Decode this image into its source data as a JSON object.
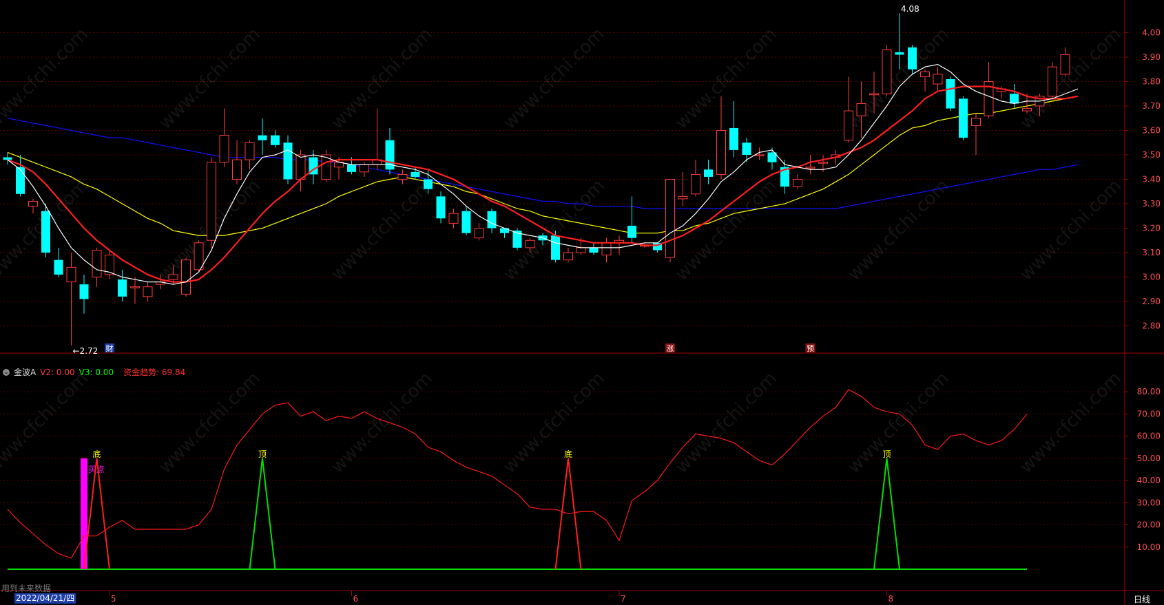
{
  "indicator": {
    "name": "金波A",
    "v2_label": "V2: 0.00",
    "v3_label": "V3: 0.00",
    "trend_label": "资金趋势: 69.84"
  },
  "footer": {
    "note": "用到未来数据",
    "date": "2022/04/21/四",
    "period": "日线"
  },
  "watermark": "www.cfchi.com",
  "colors": {
    "up": "#ff3c3c",
    "down": "#00ffff",
    "ma5": "#ffffff",
    "ma10": "#ff2020",
    "ma20": "#ffff00",
    "ma60": "#1010ff",
    "axis": "#a00000",
    "grid": "#5a0000",
    "trend": "#ff1a1a",
    "signal_bottom": "#ff2020",
    "signal_top": "#00e000",
    "magenta": "#ff00ff"
  },
  "chart_data": [
    {
      "type": "candlestick",
      "ylim": [
        2.7,
        4.1
      ],
      "y_ticks": [
        "2.80",
        "2.90",
        "3.00",
        "3.10",
        "3.20",
        "3.30",
        "3.40",
        "3.50",
        "3.60",
        "3.70",
        "3.80",
        "3.90",
        "4.00"
      ],
      "candles": [
        {
          "o": 3.49,
          "h": 3.51,
          "l": 3.46,
          "c": 3.48
        },
        {
          "o": 3.45,
          "h": 3.5,
          "l": 3.33,
          "c": 3.34
        },
        {
          "o": 3.29,
          "h": 3.32,
          "l": 3.26,
          "c": 3.31
        },
        {
          "o": 3.27,
          "h": 3.3,
          "l": 3.08,
          "c": 3.1
        },
        {
          "o": 3.07,
          "h": 3.12,
          "l": 3.0,
          "c": 3.01
        },
        {
          "o": 2.98,
          "h": 3.1,
          "l": 2.72,
          "c": 3.04
        },
        {
          "o": 2.97,
          "h": 3.01,
          "l": 2.85,
          "c": 2.91
        },
        {
          "o": 3.0,
          "h": 3.12,
          "l": 2.96,
          "c": 3.11
        },
        {
          "o": 3.01,
          "h": 3.11,
          "l": 2.99,
          "c": 3.09
        },
        {
          "o": 2.99,
          "h": 3.03,
          "l": 2.9,
          "c": 2.92
        },
        {
          "o": 2.96,
          "h": 3.0,
          "l": 2.89,
          "c": 2.96
        },
        {
          "o": 2.92,
          "h": 2.98,
          "l": 2.9,
          "c": 2.96
        },
        {
          "o": 2.97,
          "h": 3.01,
          "l": 2.95,
          "c": 2.98
        },
        {
          "o": 2.99,
          "h": 3.05,
          "l": 2.97,
          "c": 3.01
        },
        {
          "o": 2.93,
          "h": 3.08,
          "l": 2.92,
          "c": 3.07
        },
        {
          "o": 3.03,
          "h": 3.15,
          "l": 3.02,
          "c": 3.14
        },
        {
          "o": 3.15,
          "h": 3.49,
          "l": 3.12,
          "c": 3.47
        },
        {
          "o": 3.47,
          "h": 3.69,
          "l": 3.45,
          "c": 3.58
        },
        {
          "o": 3.4,
          "h": 3.56,
          "l": 3.38,
          "c": 3.48
        },
        {
          "o": 3.48,
          "h": 3.56,
          "l": 3.44,
          "c": 3.55
        },
        {
          "o": 3.58,
          "h": 3.65,
          "l": 3.5,
          "c": 3.56
        },
        {
          "o": 3.58,
          "h": 3.6,
          "l": 3.53,
          "c": 3.54
        },
        {
          "o": 3.55,
          "h": 3.58,
          "l": 3.38,
          "c": 3.4
        },
        {
          "o": 3.4,
          "h": 3.52,
          "l": 3.35,
          "c": 3.5
        },
        {
          "o": 3.49,
          "h": 3.52,
          "l": 3.38,
          "c": 3.42
        },
        {
          "o": 3.4,
          "h": 3.52,
          "l": 3.39,
          "c": 3.5
        },
        {
          "o": 3.45,
          "h": 3.49,
          "l": 3.4,
          "c": 3.47
        },
        {
          "o": 3.46,
          "h": 3.49,
          "l": 3.42,
          "c": 3.43
        },
        {
          "o": 3.43,
          "h": 3.47,
          "l": 3.41,
          "c": 3.46
        },
        {
          "o": 3.46,
          "h": 3.69,
          "l": 3.44,
          "c": 3.48
        },
        {
          "o": 3.56,
          "h": 3.61,
          "l": 3.42,
          "c": 3.44
        },
        {
          "o": 3.4,
          "h": 3.44,
          "l": 3.38,
          "c": 3.42
        },
        {
          "o": 3.43,
          "h": 3.45,
          "l": 3.4,
          "c": 3.41
        },
        {
          "o": 3.4,
          "h": 3.44,
          "l": 3.34,
          "c": 3.36
        },
        {
          "o": 3.33,
          "h": 3.35,
          "l": 3.22,
          "c": 3.24
        },
        {
          "o": 3.22,
          "h": 3.28,
          "l": 3.2,
          "c": 3.26
        },
        {
          "o": 3.27,
          "h": 3.29,
          "l": 3.17,
          "c": 3.18
        },
        {
          "o": 3.16,
          "h": 3.22,
          "l": 3.15,
          "c": 3.2
        },
        {
          "o": 3.27,
          "h": 3.28,
          "l": 3.18,
          "c": 3.2
        },
        {
          "o": 3.2,
          "h": 3.2,
          "l": 3.16,
          "c": 3.18
        },
        {
          "o": 3.19,
          "h": 3.2,
          "l": 3.11,
          "c": 3.12
        },
        {
          "o": 3.12,
          "h": 3.16,
          "l": 3.1,
          "c": 3.15
        },
        {
          "o": 3.17,
          "h": 3.18,
          "l": 3.13,
          "c": 3.15
        },
        {
          "o": 3.17,
          "h": 3.19,
          "l": 3.06,
          "c": 3.07
        },
        {
          "o": 3.07,
          "h": 3.12,
          "l": 3.06,
          "c": 3.1
        },
        {
          "o": 3.1,
          "h": 3.16,
          "l": 3.09,
          "c": 3.12
        },
        {
          "o": 3.12,
          "h": 3.14,
          "l": 3.09,
          "c": 3.1
        },
        {
          "o": 3.09,
          "h": 3.16,
          "l": 3.06,
          "c": 3.14
        },
        {
          "o": 3.14,
          "h": 3.17,
          "l": 3.09,
          "c": 3.15
        },
        {
          "o": 3.21,
          "h": 3.33,
          "l": 3.14,
          "c": 3.16
        },
        {
          "o": 3.13,
          "h": 3.14,
          "l": 3.12,
          "c": 3.13
        },
        {
          "o": 3.14,
          "h": 3.14,
          "l": 3.1,
          "c": 3.11
        },
        {
          "o": 3.08,
          "h": 3.4,
          "l": 3.06,
          "c": 3.4
        },
        {
          "o": 3.32,
          "h": 3.43,
          "l": 3.29,
          "c": 3.33
        },
        {
          "o": 3.34,
          "h": 3.48,
          "l": 3.33,
          "c": 3.42
        },
        {
          "o": 3.44,
          "h": 3.48,
          "l": 3.38,
          "c": 3.41
        },
        {
          "o": 3.42,
          "h": 3.74,
          "l": 3.4,
          "c": 3.6
        },
        {
          "o": 3.61,
          "h": 3.72,
          "l": 3.49,
          "c": 3.52
        },
        {
          "o": 3.55,
          "h": 3.57,
          "l": 3.47,
          "c": 3.5
        },
        {
          "o": 3.5,
          "h": 3.53,
          "l": 3.48,
          "c": 3.5
        },
        {
          "o": 3.51,
          "h": 3.53,
          "l": 3.44,
          "c": 3.47
        },
        {
          "o": 3.45,
          "h": 3.48,
          "l": 3.34,
          "c": 3.37
        },
        {
          "o": 3.37,
          "h": 3.42,
          "l": 3.36,
          "c": 3.4
        },
        {
          "o": 3.45,
          "h": 3.5,
          "l": 3.42,
          "c": 3.45
        },
        {
          "o": 3.47,
          "h": 3.5,
          "l": 3.43,
          "c": 3.47
        },
        {
          "o": 3.49,
          "h": 3.52,
          "l": 3.46,
          "c": 3.5
        },
        {
          "o": 3.56,
          "h": 3.82,
          "l": 3.55,
          "c": 3.68
        },
        {
          "o": 3.66,
          "h": 3.8,
          "l": 3.57,
          "c": 3.71
        },
        {
          "o": 3.75,
          "h": 3.84,
          "l": 3.67,
          "c": 3.75
        },
        {
          "o": 3.75,
          "h": 3.95,
          "l": 3.74,
          "c": 3.93
        },
        {
          "o": 3.92,
          "h": 4.08,
          "l": 3.85,
          "c": 3.91
        },
        {
          "o": 3.94,
          "h": 3.95,
          "l": 3.83,
          "c": 3.85
        },
        {
          "o": 3.82,
          "h": 3.85,
          "l": 3.76,
          "c": 3.84
        },
        {
          "o": 3.79,
          "h": 3.86,
          "l": 3.76,
          "c": 3.83
        },
        {
          "o": 3.81,
          "h": 3.82,
          "l": 3.68,
          "c": 3.69
        },
        {
          "o": 3.73,
          "h": 3.74,
          "l": 3.56,
          "c": 3.57
        },
        {
          "o": 3.62,
          "h": 3.67,
          "l": 3.5,
          "c": 3.65
        },
        {
          "o": 3.66,
          "h": 3.88,
          "l": 3.65,
          "c": 3.8
        },
        {
          "o": 3.76,
          "h": 3.78,
          "l": 3.73,
          "c": 3.77
        },
        {
          "o": 3.75,
          "h": 3.79,
          "l": 3.69,
          "c": 3.71
        },
        {
          "o": 3.68,
          "h": 3.75,
          "l": 3.67,
          "c": 3.69
        },
        {
          "o": 3.7,
          "h": 3.75,
          "l": 3.66,
          "c": 3.74
        },
        {
          "o": 3.74,
          "h": 3.88,
          "l": 3.73,
          "c": 3.86
        },
        {
          "o": 3.83,
          "h": 3.94,
          "l": 3.82,
          "c": 3.91
        }
      ],
      "ma5": [
        3.48,
        3.44,
        3.37,
        3.29,
        3.2,
        3.12,
        3.07,
        3.03,
        3.02,
        3.0,
        2.99,
        2.98,
        2.98,
        2.97,
        2.98,
        3.02,
        3.11,
        3.24,
        3.34,
        3.43,
        3.49,
        3.5,
        3.52,
        3.49,
        3.5,
        3.49,
        3.47,
        3.46,
        3.46,
        3.46,
        3.46,
        3.45,
        3.44,
        3.42,
        3.38,
        3.34,
        3.29,
        3.25,
        3.22,
        3.2,
        3.18,
        3.17,
        3.16,
        3.14,
        3.13,
        3.12,
        3.12,
        3.12,
        3.12,
        3.13,
        3.14,
        3.14,
        3.18,
        3.21,
        3.26,
        3.32,
        3.39,
        3.43,
        3.48,
        3.51,
        3.52,
        3.46,
        3.45,
        3.44,
        3.44,
        3.45,
        3.5,
        3.56,
        3.63,
        3.7,
        3.78,
        3.83,
        3.86,
        3.87,
        3.84,
        3.79,
        3.76,
        3.74,
        3.72,
        3.71,
        3.72,
        3.72,
        3.73,
        3.75,
        3.77
      ],
      "ma10": [
        3.48,
        3.46,
        3.43,
        3.38,
        3.32,
        3.26,
        3.2,
        3.15,
        3.11,
        3.07,
        3.04,
        3.01,
        2.99,
        2.98,
        2.98,
        2.99,
        3.03,
        3.08,
        3.14,
        3.2,
        3.26,
        3.31,
        3.35,
        3.4,
        3.44,
        3.47,
        3.48,
        3.48,
        3.48,
        3.48,
        3.47,
        3.46,
        3.45,
        3.44,
        3.42,
        3.4,
        3.37,
        3.34,
        3.31,
        3.29,
        3.26,
        3.23,
        3.2,
        3.17,
        3.16,
        3.15,
        3.14,
        3.14,
        3.14,
        3.14,
        3.13,
        3.13,
        3.15,
        3.17,
        3.2,
        3.23,
        3.27,
        3.31,
        3.35,
        3.39,
        3.42,
        3.44,
        3.45,
        3.47,
        3.48,
        3.49,
        3.51,
        3.53,
        3.56,
        3.6,
        3.64,
        3.68,
        3.73,
        3.76,
        3.77,
        3.78,
        3.78,
        3.78,
        3.77,
        3.76,
        3.74,
        3.73,
        3.73,
        3.73,
        3.74
      ],
      "ma20": [
        3.51,
        3.49,
        3.47,
        3.45,
        3.43,
        3.41,
        3.38,
        3.36,
        3.33,
        3.3,
        3.27,
        3.24,
        3.22,
        3.19,
        3.18,
        3.17,
        3.17,
        3.17,
        3.18,
        3.19,
        3.2,
        3.22,
        3.24,
        3.26,
        3.28,
        3.3,
        3.33,
        3.35,
        3.37,
        3.39,
        3.4,
        3.41,
        3.4,
        3.39,
        3.38,
        3.37,
        3.35,
        3.34,
        3.32,
        3.3,
        3.28,
        3.27,
        3.25,
        3.24,
        3.23,
        3.22,
        3.21,
        3.2,
        3.19,
        3.18,
        3.18,
        3.18,
        3.19,
        3.19,
        3.21,
        3.22,
        3.24,
        3.26,
        3.27,
        3.28,
        3.29,
        3.3,
        3.32,
        3.34,
        3.36,
        3.39,
        3.42,
        3.46,
        3.5,
        3.54,
        3.58,
        3.61,
        3.62,
        3.64,
        3.65,
        3.66,
        3.67,
        3.67,
        3.68,
        3.69,
        3.7,
        3.71,
        3.72,
        3.73,
        3.74
      ],
      "ma60": [
        3.65,
        3.64,
        3.63,
        3.62,
        3.61,
        3.6,
        3.59,
        3.58,
        3.57,
        3.57,
        3.56,
        3.55,
        3.54,
        3.53,
        3.52,
        3.51,
        3.5,
        3.49,
        3.49,
        3.49,
        3.49,
        3.49,
        3.48,
        3.48,
        3.48,
        3.47,
        3.47,
        3.46,
        3.45,
        3.44,
        3.43,
        3.42,
        3.41,
        3.4,
        3.39,
        3.38,
        3.37,
        3.36,
        3.35,
        3.34,
        3.33,
        3.32,
        3.31,
        3.31,
        3.3,
        3.3,
        3.29,
        3.29,
        3.29,
        3.29,
        3.28,
        3.28,
        3.28,
        3.28,
        3.28,
        3.28,
        3.28,
        3.28,
        3.28,
        3.28,
        3.28,
        3.28,
        3.28,
        3.28,
        3.28,
        3.28,
        3.29,
        3.3,
        3.31,
        3.32,
        3.33,
        3.34,
        3.35,
        3.36,
        3.37,
        3.38,
        3.39,
        3.4,
        3.41,
        3.42,
        3.43,
        3.44,
        3.44,
        3.45,
        3.46
      ],
      "annotations": [
        {
          "text": "←2.72",
          "index": 5,
          "price": 2.72
        },
        {
          "text": "4.08",
          "index": 70,
          "price": 4.08
        }
      ],
      "event_markers": [
        {
          "text": "财",
          "index": 8,
          "color": "#ffffff",
          "bg": "#1e3fa8"
        },
        {
          "text": "涨",
          "index": 52,
          "color": "#ffffff",
          "bg": "#8a1010"
        },
        {
          "text": "预",
          "index": 63,
          "color": "#ffffff",
          "bg": "#8a1010"
        }
      ]
    },
    {
      "type": "line",
      "ylim": [
        0,
        90
      ],
      "y_ticks": [
        "10.00",
        "20.00",
        "30.00",
        "40.00",
        "50.00",
        "60.00",
        "70.00",
        "80.00"
      ],
      "trend": [
        27,
        21,
        16,
        11,
        7,
        5,
        15,
        15,
        19,
        22,
        18,
        18,
        18,
        18,
        18,
        20,
        27,
        45,
        56,
        63,
        70,
        74,
        75,
        69,
        71,
        67,
        69,
        68,
        71,
        68,
        66,
        64,
        61,
        55,
        53,
        49,
        46,
        44,
        42,
        38,
        34,
        28,
        27,
        27,
        25,
        26,
        26,
        22,
        13,
        31,
        35,
        40,
        48,
        55,
        61,
        60,
        59,
        57,
        53,
        49,
        47,
        52,
        58,
        64,
        69,
        73,
        81,
        78,
        73,
        71,
        70,
        65,
        56,
        54,
        60,
        61,
        58,
        56,
        58,
        63,
        70
      ],
      "signals": [
        {
          "type": "bottom",
          "index": 7,
          "text": "底",
          "height": 50
        },
        {
          "type": "top",
          "index": 20,
          "text": "顶",
          "height": 50
        },
        {
          "type": "bottom",
          "index": 44,
          "text": "底",
          "height": 50
        },
        {
          "type": "top",
          "index": 69,
          "text": "顶",
          "height": 50
        }
      ],
      "magenta_bar": {
        "index": 6,
        "height": 50,
        "text": "买点"
      },
      "x_ticks": [
        {
          "text": "5",
          "index": 8
        },
        {
          "text": "6",
          "index": 27
        },
        {
          "text": "7",
          "index": 48
        },
        {
          "text": "8",
          "index": 69
        }
      ]
    }
  ]
}
